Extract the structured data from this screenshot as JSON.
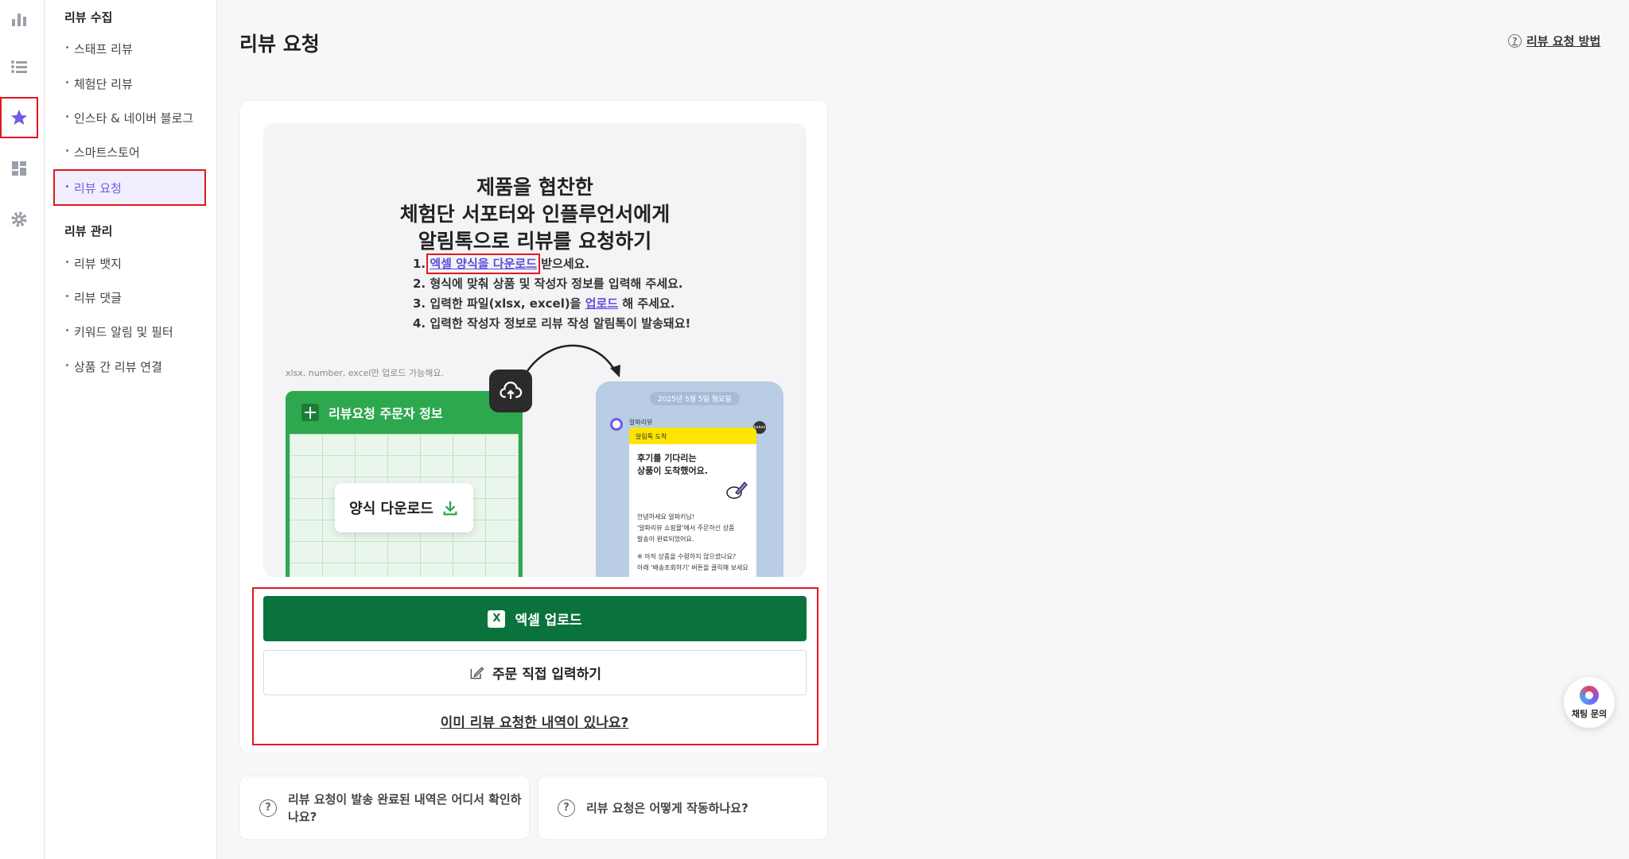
{
  "rail": {
    "icons": [
      "bar-chart-icon",
      "list-icon",
      "star-icon",
      "dashboard-icon",
      "gear-icon"
    ],
    "active_color": "#6b5ce7"
  },
  "menu": {
    "group1_title": "리뷰 수집",
    "group1_items": [
      "스태프 리뷰",
      "체험단 리뷰",
      "인스타 & 네이버 블로그",
      "스마트스토어",
      "리뷰 요청"
    ],
    "group2_title": "리뷰 관리",
    "group2_items": [
      "리뷰 뱃지",
      "리뷰 댓글",
      "키워드 알림 및 필터",
      "상품 간 리뷰 연결"
    ]
  },
  "header": {
    "title": "리뷰 요청",
    "help_icon": "?",
    "help_label": "리뷰 요청 방법"
  },
  "hero": {
    "title_line1": "제품을 협찬한",
    "title_line2": "체험단 서포터와 인플루언서에게",
    "title_line3": "알림톡으로 리뷰를 요청하기",
    "step1_prefix": "1. ",
    "step1_link": "엑셀 양식을 다운로드",
    "step1_suffix": " 받으세요.",
    "step2": "2. 형식에 맞춰 상품 및 작성자 정보를 입력해 주세요.",
    "step3_prefix": "3. 입력한 파일(xlsx, excel)을 ",
    "step3_link": "업로드",
    "step3_suffix": " 해 주세요.",
    "step4": "4. 입력한 작성자 정보로 리뷰 작성 알림톡이 발송돼요!",
    "note": "xlsx, number, excel만 업로드 가능해요.",
    "sheet_title": "리뷰요청 주문자 정보",
    "sheet_icon": "十",
    "download_chip": "양식 다운로드",
    "phone_date": "2025년 5월 5일 월요일",
    "phone_sender": "알파리뷰",
    "kakao_badge": "kakao",
    "phone_msg_top": "알림톡 도착",
    "phone_msg_head1": "후기를 기다리는",
    "phone_msg_head2": "상품이 도착했어요.",
    "phone_msg_body1": "안녕하세요 알파키님!",
    "phone_msg_body2": "'알파리뷰 쇼핑몰'에서 주문하신 상품",
    "phone_msg_body3": "발송이 완료되었어요.",
    "phone_msg_body4": "※ 아직 상품을 수령하지 않으셨나요?",
    "phone_msg_body5": "아래 '배송조회하기' 버튼을 클릭해 보세요"
  },
  "actions": {
    "excel_icon": "X",
    "excel_upload": "엑셀 업로드",
    "manual_input": "주문 직접 입력하기",
    "history_link": "이미 리뷰 요청한 내역이 있나요?"
  },
  "faq": {
    "icon": "?",
    "q1": "리뷰 요청이 발송 완료된 내역은 어디서 확인하나요?",
    "q2": "리뷰 요청은 어떻게 작동하나요?"
  },
  "chat": {
    "label": "채팅 문의"
  },
  "colors": {
    "accent": "#6b5ce7",
    "excel_green": "#0a733b",
    "highlight_red": "#e0191f"
  }
}
